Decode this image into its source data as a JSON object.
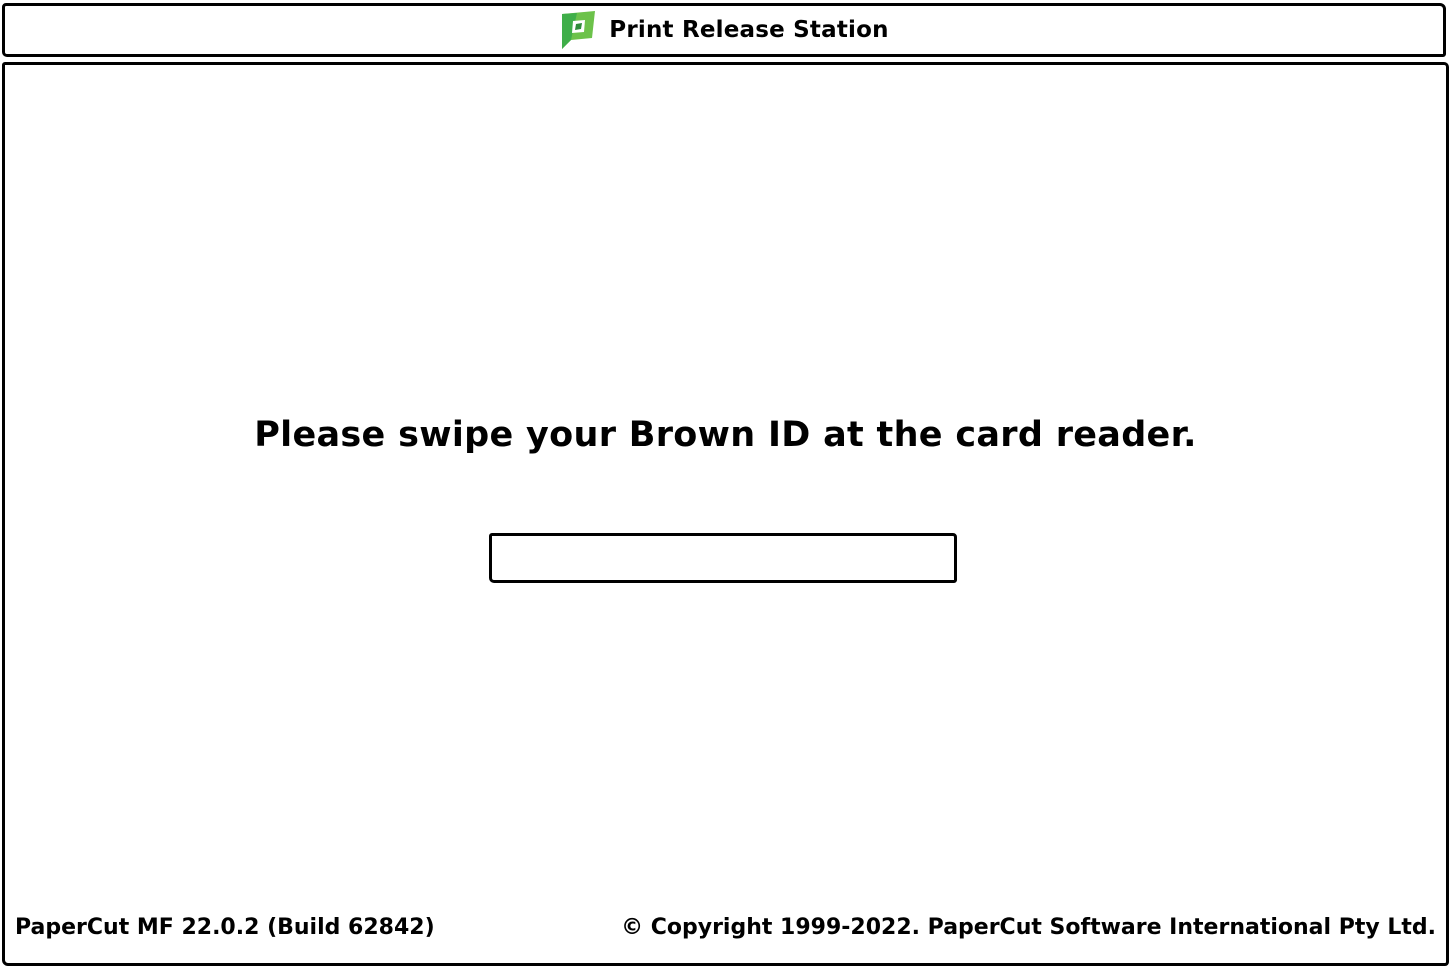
{
  "header": {
    "title": "Print Release Station",
    "logo_icon": "papercut-logo-icon",
    "logo_colors": [
      "#5cb85c",
      "#2e9e4a"
    ]
  },
  "main": {
    "prompt": "Please swipe your Brown ID at the card reader.",
    "card_input": {
      "value": "",
      "placeholder": ""
    }
  },
  "footer": {
    "version": "PaperCut MF 22.0.2 (Build 62842)",
    "copyright": "© Copyright 1999-2022. PaperCut Software International Pty Ltd."
  }
}
